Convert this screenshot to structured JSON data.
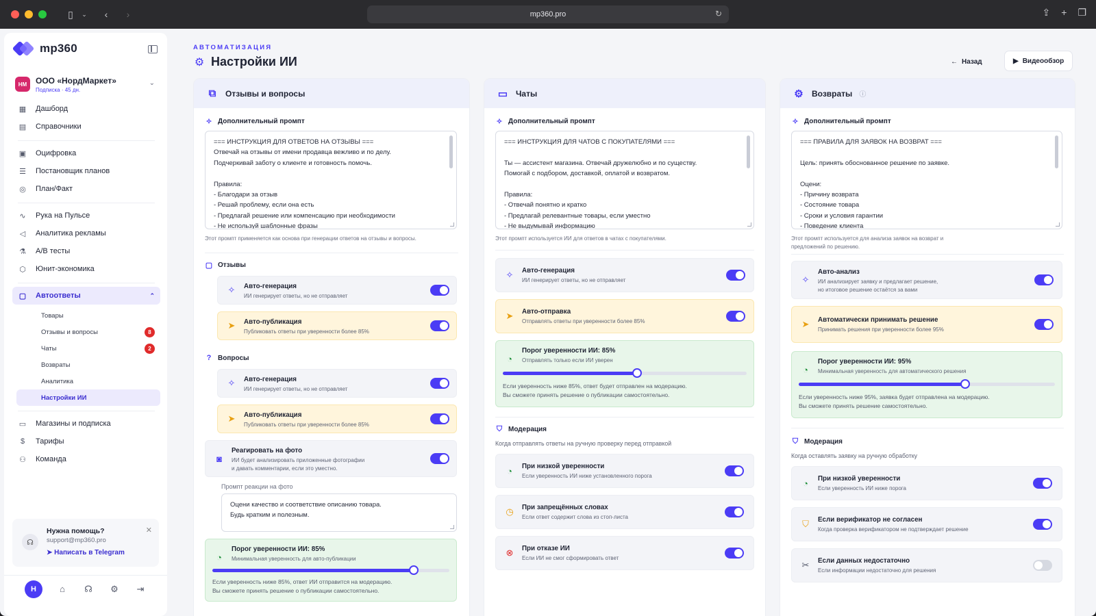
{
  "browser": {
    "url": "mp360.pro"
  },
  "sidebar": {
    "logo": "mp360",
    "org": {
      "avatar": "НМ",
      "name": "ООО «НордМаркет»",
      "sub": "Подписка · 45 дн."
    },
    "groups": [
      [
        {
          "label": "Дашборд",
          "icon": "grid-icon",
          "glyph": "▦"
        },
        {
          "label": "Справочники",
          "icon": "book-icon",
          "glyph": "▤"
        }
      ],
      [
        {
          "label": "Оцифровка",
          "icon": "calendar-icon",
          "glyph": "▣"
        },
        {
          "label": "Постановщик планов",
          "icon": "list-icon",
          "glyph": "☰"
        },
        {
          "label": "План/Факт",
          "icon": "target-icon",
          "glyph": "◎"
        }
      ],
      [
        {
          "label": "Рука на Пульсе",
          "icon": "pulse-icon",
          "glyph": "∿"
        },
        {
          "label": "Аналитика рекламы",
          "icon": "megaphone-icon",
          "glyph": "◁"
        },
        {
          "label": "A/B тесты",
          "icon": "flask-icon",
          "glyph": "⚗"
        },
        {
          "label": "Юнит-экономика",
          "icon": "cube-icon",
          "glyph": "⬡"
        }
      ]
    ],
    "autoreplies": {
      "label": "Автоответы",
      "icon": "message-icon",
      "sub": [
        {
          "label": "Товары"
        },
        {
          "label": "Отзывы и вопросы",
          "badge": "8"
        },
        {
          "label": "Чаты",
          "badge": "2"
        },
        {
          "label": "Возвраты"
        },
        {
          "label": "Аналитика"
        },
        {
          "label": "Настройки ИИ"
        }
      ]
    },
    "bottom": [
      {
        "label": "Магазины и подписка",
        "glyph": "▭"
      },
      {
        "label": "Тарифы",
        "glyph": "$"
      },
      {
        "label": "Команда",
        "glyph": "⚇"
      }
    ],
    "help": {
      "title": "Нужна помощь?",
      "email": "support@mp360.pro",
      "link": "Написать в Telegram"
    },
    "user_initial": "Н"
  },
  "header": {
    "crumb": "АВТОМАТИЗАЦИЯ",
    "title": "Настройки ИИ",
    "back": "Назад",
    "video": "Видеообзор"
  },
  "reviews": {
    "title": "Отзывы и вопросы",
    "prompt_label": "Дополнительный промпт",
    "prompt": "=== ИНСТРУКЦИЯ ДЛЯ ОТВЕТОВ НА ОТЗЫВЫ ===\nОтвечай на отзывы от имени продавца вежливо и по делу.\nПодчеркивай заботу о клиенте и готовность помочь.\n\nПравила:\n- Благодари за отзыв\n- Решай проблему, если она есть\n- Предлагай решение или компенсацию при необходимости\n- Не используй шаблонные фразы",
    "hint": "Этот промпт применяется как основа при генерации ответов на отзывы и вопросы.",
    "reviews_label": "Отзывы",
    "questions_label": "Вопросы",
    "auto_gen": {
      "title": "Авто-генерация",
      "sub": "ИИ генерирует ответы, но не отправляет"
    },
    "auto_pub": {
      "title": "Авто-публикация",
      "sub": "Публиковать ответы при уверенности более 85%"
    },
    "photo": {
      "title": "Реагировать на фото",
      "sub1": "ИИ будет анализировать приложенные фотографии",
      "sub2": "и давать комментарии, если это уместно."
    },
    "photo_prompt_label": "Промпт реакции на фото",
    "photo_prompt": "Оцени качество и соответствие описанию товара.\nБудь кратким и полезным.",
    "threshold": {
      "title": "Порог уверенности ИИ: 85%",
      "sub": "Минимальная уверенность для авто-публикации",
      "value": 0.85,
      "note": "Если уверенность ниже 85%, ответ ИИ отправится на модерацию.\nВы сможете принять решение о публикации самостоятельно."
    }
  },
  "chats": {
    "title": "Чаты",
    "prompt_label": "Дополнительный промпт",
    "prompt": "=== ИНСТРУКЦИЯ ДЛЯ ЧАТОВ С ПОКУПАТЕЛЯМИ ===\n\nТы — ассистент магазина. Отвечай дружелюбно и по существу.\nПомогай с подбором, доставкой, оплатой и возвратом.\n\nПравила:\n- Отвечай понятно и кратко\n- Предлагай релевантные товары, если уместно\n- Не выдумывай информацию",
    "hint": "Этот промпт используется ИИ для ответов в чатах с покупателями.",
    "auto_gen": {
      "title": "Авто-генерация",
      "sub": "ИИ генерирует ответы, но не отправляет"
    },
    "auto_send": {
      "title": "Авто-отправка",
      "sub": "Отправлять ответы при уверенности более 85%"
    },
    "threshold": {
      "title": "Порог уверенности ИИ: 85%",
      "sub": "Отправлять только если ИИ уверен",
      "value": 0.55,
      "note": "Если уверенность ниже 85%, ответ будет отправлен на модерацию.\nВы сможете принять решение о публикации самостоятельно."
    },
    "moderation": {
      "title": "Модерация",
      "sub": "Когда отправлять ответы на ручную проверку перед отправкой",
      "items": [
        {
          "title": "При низкой уверенности",
          "sub": "Если уверенность ИИ ниже установленного порога",
          "on": true
        },
        {
          "title": "При запрещённых словах",
          "sub": "Если ответ содержит слова из стоп-листа",
          "on": true
        },
        {
          "title": "При отказе ИИ",
          "sub": "Если ИИ не смог сформировать ответ",
          "on": true
        }
      ]
    }
  },
  "returns": {
    "title": "Возвраты",
    "prompt_label": "Дополнительный промпт",
    "prompt": "=== ПРАВИЛА ДЛЯ ЗАЯВОК НА ВОЗВРАТ ===\n\nЦель: принять обоснованное решение по заявке.\n\nОцени:\n- Причину возврата\n- Состояние товара\n- Сроки и условия гарантии\n- Поведение клиента",
    "hint": "Этот промпт используется для анализа заявок на возврат и\nпредложений по решению.",
    "auto_analysis": {
      "title": "Авто-анализ",
      "sub1": "ИИ анализирует заявку и предлагает решение,",
      "sub2": "но итоговое решение остаётся за вами"
    },
    "auto_decide": {
      "title": "Автоматически принимать решение",
      "sub": "Принимать решения при уверенности более 95%"
    },
    "threshold": {
      "title": "Порог уверенности ИИ: 95%",
      "sub": "Минимальная уверенность для автоматического решения",
      "value": 0.65,
      "note": "Если уверенность ниже 95%, заявка будет отправлена на модерацию.\nВы сможете принять решение самостоятельно."
    },
    "moderation": {
      "title": "Модерация",
      "sub": "Когда оставлять заявку на ручную обработку",
      "items": [
        {
          "title": "При низкой уверенности",
          "sub": "Если уверенность ИИ ниже порога",
          "on": true
        },
        {
          "title": "Если верификатор не согласен",
          "sub": "Когда проверка верификатором не подтверждает решение",
          "on": true
        },
        {
          "title": "Если данных недостаточно",
          "sub": "Если информации недостаточно для решения",
          "on": false
        }
      ]
    }
  },
  "colors": {
    "accent": "#4b3cf5",
    "yellow_card": "#fff5dc",
    "green_card": "#e8f6ea",
    "danger": "#e02b2b"
  }
}
